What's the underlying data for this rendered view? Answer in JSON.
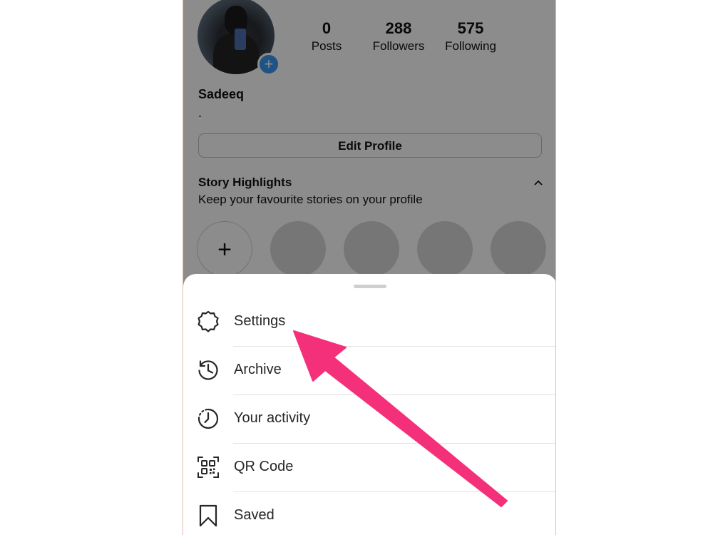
{
  "profile": {
    "stats": [
      {
        "value": "0",
        "label": "Posts"
      },
      {
        "value": "288",
        "label": "Followers"
      },
      {
        "value": "575",
        "label": "Following"
      }
    ],
    "username": "Sadeeq",
    "bio": ".",
    "edit_profile_label": "Edit Profile",
    "highlights": {
      "title": "Story Highlights",
      "subtitle": "Keep your favourite stories on your profile",
      "new_label": "+"
    }
  },
  "menu": {
    "items": [
      {
        "label": "Settings",
        "icon": "settings-gear-icon"
      },
      {
        "label": "Archive",
        "icon": "archive-history-icon"
      },
      {
        "label": "Your activity",
        "icon": "activity-clock-icon"
      },
      {
        "label": "QR Code",
        "icon": "qr-code-icon"
      },
      {
        "label": "Saved",
        "icon": "bookmark-icon"
      }
    ]
  },
  "colors": {
    "arrow": "#f5307a",
    "badge": "#3797f0",
    "overlay": "rgba(0,0,0,0.45)"
  }
}
